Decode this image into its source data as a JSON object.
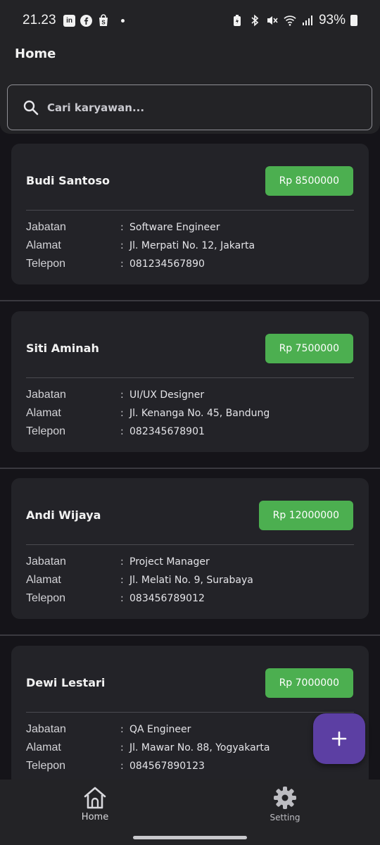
{
  "status_bar": {
    "time": "21.23",
    "battery": "93%",
    "left_icons": [
      "linkedin-icon",
      "facebook-icon",
      "shopee-icon",
      "dot-icon"
    ],
    "right_icons": [
      "battery-saver-icon",
      "bluetooth-icon",
      "mute-icon",
      "wifi-icon",
      "signal-icon",
      "battery-icon"
    ]
  },
  "app_bar": {
    "title": "Home",
    "search": {
      "placeholder": "Cari karyawan...",
      "value": ""
    }
  },
  "employees": [
    {
      "name": "Budi Santoso",
      "salary": "Rp 8500000",
      "jabatan": "Software Engineer",
      "alamat": "Jl. Merpati No. 12, Jakarta",
      "telepon": "081234567890"
    },
    {
      "name": "Siti Aminah",
      "salary": "Rp 7500000",
      "jabatan": "UI/UX Designer",
      "alamat": "Jl. Kenanga No. 45, Bandung",
      "telepon": "082345678901"
    },
    {
      "name": "Andi Wijaya",
      "salary": "Rp 12000000",
      "jabatan": "Project Manager",
      "alamat": "Jl. Melati No. 9, Surabaya",
      "telepon": "083456789012"
    },
    {
      "name": "Dewi Lestari",
      "salary": "Rp 7000000",
      "jabatan": "QA Engineer",
      "alamat": "Jl. Mawar No. 88, Yogyakarta",
      "telepon": "084567890123"
    }
  ],
  "labels": {
    "jabatan": "Jabatan",
    "alamat": "Alamat",
    "telepon": "Telepon",
    "colon": ":"
  },
  "fab": {
    "icon": "plus-icon"
  },
  "bottom_nav": {
    "items": [
      {
        "label": "Home",
        "icon": "home-icon"
      },
      {
        "label": "Setting",
        "icon": "gear-icon"
      }
    ]
  },
  "colors": {
    "background": "#151419",
    "surface": "#232326",
    "card": "#232328",
    "salary_badge": "#4caf50",
    "fab": "#5c3fa3"
  }
}
